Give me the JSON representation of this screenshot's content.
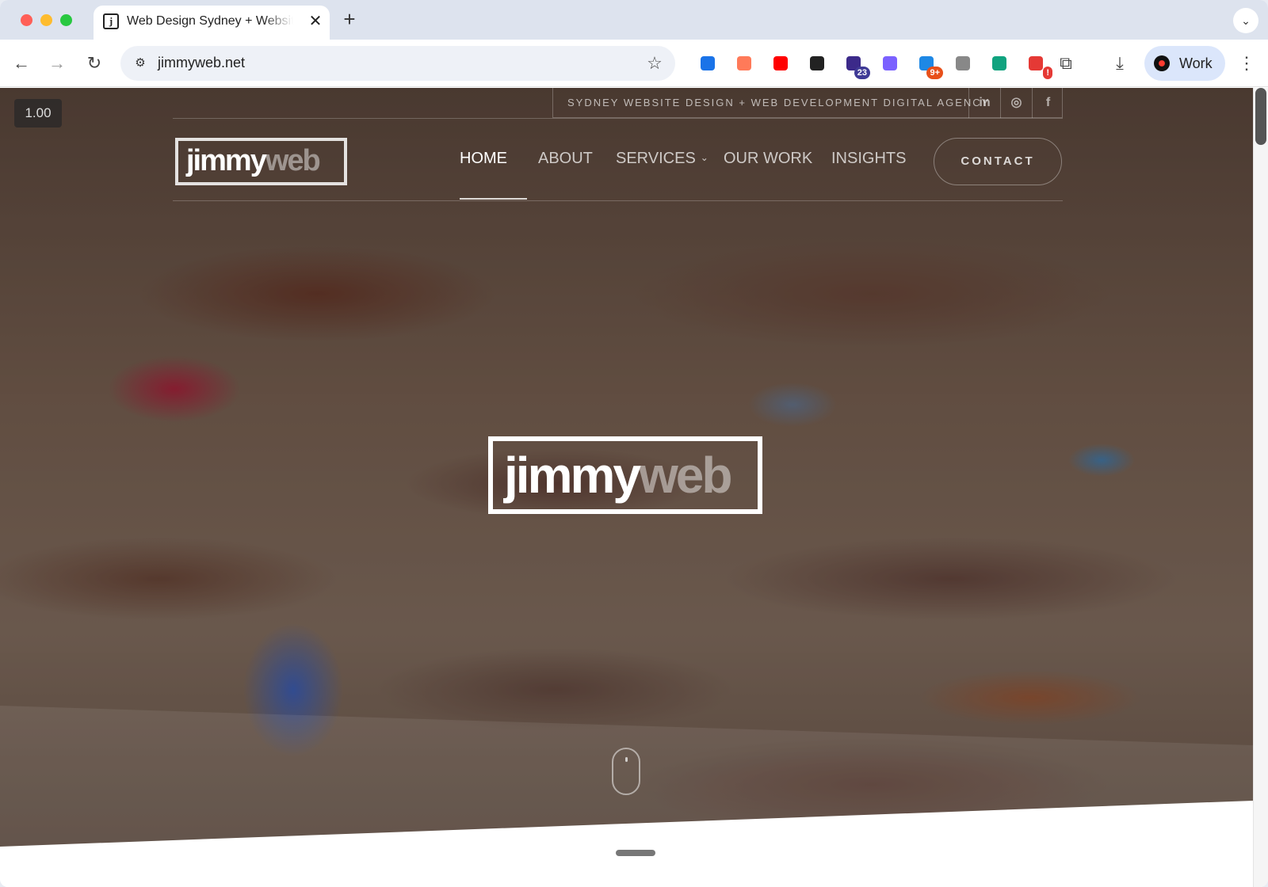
{
  "browser": {
    "tab_title": "Web Design Sydney + Website",
    "tab_close": "✕",
    "new_tab": "+",
    "url": "jimmyweb.net",
    "profile_label": "Work",
    "extensions": [
      {
        "name": "bolt",
        "color": "#1a73e8",
        "badge": ""
      },
      {
        "name": "hubspot",
        "color": "#ff7a59",
        "badge": ""
      },
      {
        "name": "youtube",
        "color": "#ff0000",
        "badge": ""
      },
      {
        "name": "pen",
        "color": "#222222",
        "badge": ""
      },
      {
        "name": "graduation-cap",
        "color": "#3c2a8a",
        "badge": "23"
      },
      {
        "name": "d-logo",
        "color": "#7b61ff",
        "badge": ""
      },
      {
        "name": "puzzle-blue",
        "color": "#1e88e5",
        "badge": "9+"
      },
      {
        "name": "camera",
        "color": "#888888",
        "badge": ""
      },
      {
        "name": "chat-bubble",
        "color": "#10a37f",
        "badge": ""
      },
      {
        "name": "shield-red",
        "color": "#e53935",
        "badge": "!"
      }
    ]
  },
  "page": {
    "zoom": "1.00",
    "tagline": "SYDNEY WEBSITE DESIGN + WEB DEVELOPMENT DIGITAL AGENCY",
    "social": [
      "in",
      "◎",
      "f"
    ],
    "logo_part1": "jimmy",
    "logo_part2": "web",
    "nav": [
      {
        "label": "HOME",
        "active": true
      },
      {
        "label": "ABOUT",
        "active": false
      },
      {
        "label": "SERVICES",
        "active": false,
        "has_dropdown": true
      },
      {
        "label": "OUR WORK",
        "active": false
      },
      {
        "label": "INSIGHTS",
        "active": false
      }
    ],
    "contact_label": "CONTACT",
    "hero_bg_color": "#7e6655"
  }
}
